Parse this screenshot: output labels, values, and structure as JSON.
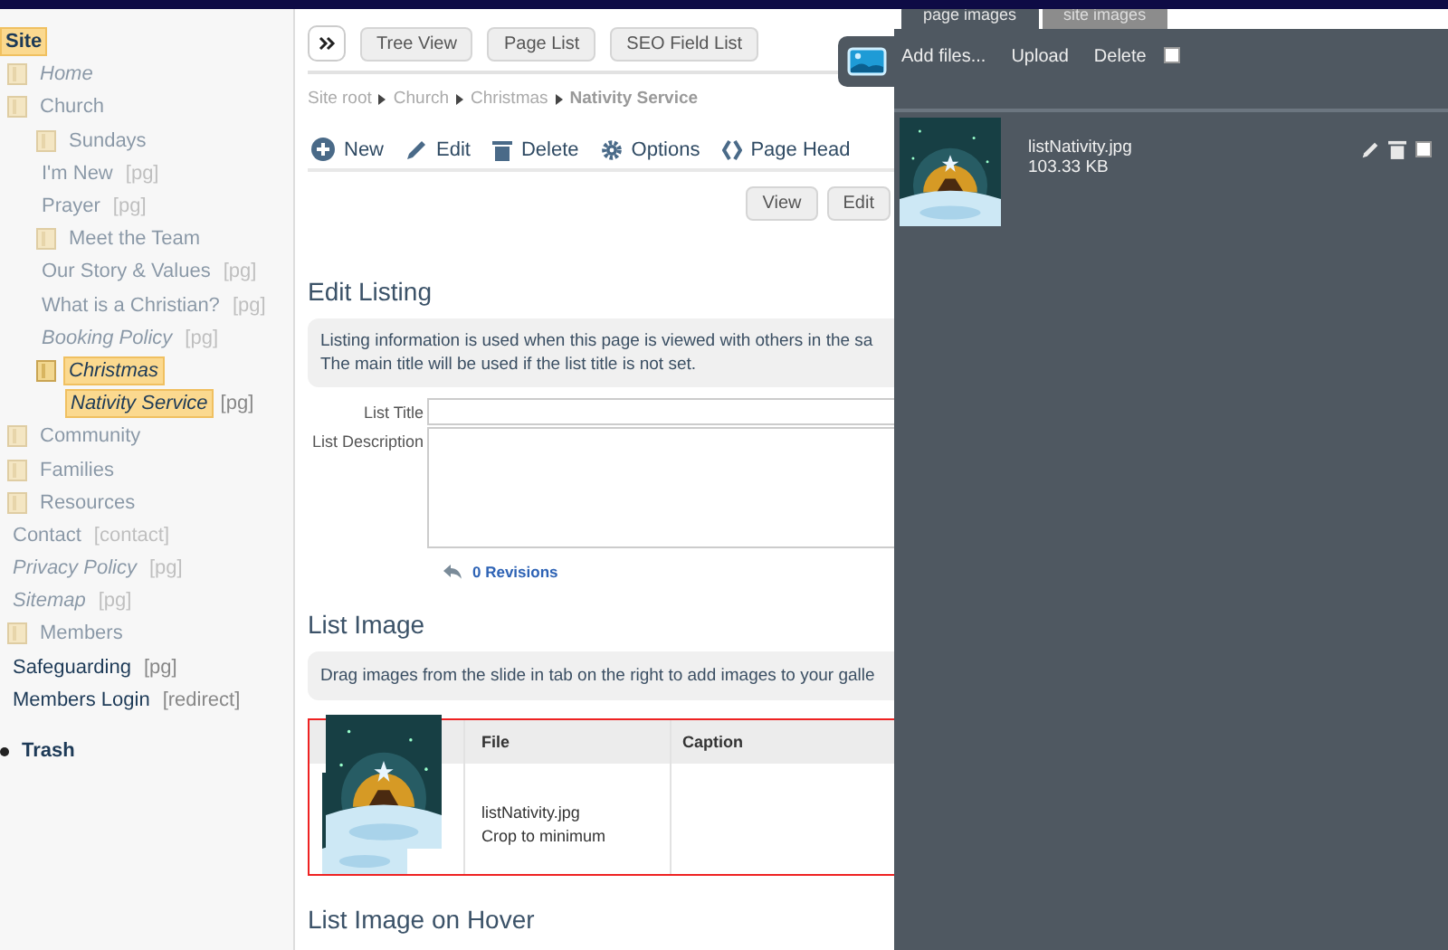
{
  "tree": {
    "items": [
      {
        "label": "Site",
        "kind": "root",
        "italic": false,
        "selected": true,
        "faded": false,
        "children": [
          {
            "label": "Home",
            "kind": "folder",
            "italic": true,
            "selected": false,
            "faded": true
          },
          {
            "label": "Church",
            "kind": "folder",
            "italic": false,
            "selected": false,
            "faded": true,
            "children": [
              {
                "label": "Sundays",
                "kind": "folder",
                "italic": false,
                "selected": false,
                "faded": true
              },
              {
                "label": "I'm New",
                "tag": "[pg]",
                "kind": "page",
                "italic": false,
                "selected": false,
                "faded": true
              },
              {
                "label": "Prayer",
                "tag": "[pg]",
                "kind": "page",
                "italic": false,
                "selected": false,
                "faded": true
              },
              {
                "label": "Meet the Team",
                "kind": "folder",
                "italic": false,
                "selected": false,
                "faded": true
              },
              {
                "label": "Our Story & Values",
                "tag": "[pg]",
                "kind": "page",
                "italic": false,
                "selected": false,
                "faded": true
              },
              {
                "label": "What is a Christian?",
                "tag": "[pg]",
                "kind": "page",
                "italic": false,
                "selected": false,
                "faded": true
              },
              {
                "label": "Booking Policy",
                "tag": "[pg]",
                "kind": "page",
                "italic": true,
                "selected": false,
                "faded": true
              },
              {
                "label": "Christmas",
                "kind": "folder",
                "italic": true,
                "selected": true,
                "faded": false,
                "children": [
                  {
                    "label": "Nativity Service",
                    "tag": "[pg]",
                    "kind": "page",
                    "italic": true,
                    "selected": true,
                    "faded": false
                  }
                ]
              }
            ]
          },
          {
            "label": "Community",
            "kind": "folder",
            "italic": false,
            "selected": false,
            "faded": true
          },
          {
            "label": "Families",
            "kind": "folder",
            "italic": false,
            "selected": false,
            "faded": true
          },
          {
            "label": "Resources",
            "kind": "folder",
            "italic": false,
            "selected": false,
            "faded": true
          },
          {
            "label": "Contact",
            "tag": "[contact]",
            "kind": "page",
            "italic": false,
            "selected": false,
            "faded": true
          },
          {
            "label": "Privacy Policy",
            "tag": "[pg]",
            "kind": "page",
            "italic": true,
            "selected": false,
            "faded": true
          },
          {
            "label": "Sitemap",
            "tag": "[pg]",
            "kind": "page",
            "italic": true,
            "selected": false,
            "faded": true
          },
          {
            "label": "Members",
            "kind": "folder",
            "italic": false,
            "selected": false,
            "faded": true
          },
          {
            "label": "Safeguarding",
            "tag": "[pg]",
            "kind": "page",
            "italic": false,
            "selected": false,
            "faded": false
          },
          {
            "label": "Members Login",
            "tag": "[redirect]",
            "kind": "page",
            "italic": false,
            "selected": false,
            "faded": false
          }
        ]
      }
    ],
    "trash": "Trash"
  },
  "view_tabs": [
    "Tree View",
    "Page List",
    "SEO Field List"
  ],
  "breadcrumb": [
    {
      "label": "Site root",
      "current": false
    },
    {
      "label": "Church",
      "current": false
    },
    {
      "label": "Christmas",
      "current": false
    },
    {
      "label": "Nativity Service",
      "current": true
    }
  ],
  "actions": [
    {
      "label": "New",
      "kind": "plus"
    },
    {
      "label": "Edit",
      "kind": "pencil"
    },
    {
      "label": "Delete",
      "kind": "trash"
    },
    {
      "label": "Options",
      "kind": "gear"
    },
    {
      "label": "Page Head",
      "kind": "code"
    }
  ],
  "mode_buttons": [
    "View",
    "Edit"
  ],
  "edit_listing": {
    "heading": "Edit Listing",
    "info": [
      "Listing information is used when this page is viewed with others in the sa",
      "The main title will be used if the list title is not set."
    ],
    "fields": [
      {
        "label": "List Title",
        "kind": "input"
      },
      {
        "label": "List Description",
        "kind": "textarea"
      }
    ],
    "revisions": "0 Revisions"
  },
  "list_image": {
    "heading": "List Image",
    "info": "Drag images from the slide in tab on the right to add images to your galle",
    "table": {
      "columns": [
        "File",
        "Caption"
      ],
      "rows": [
        {
          "file": "listNativity.jpg",
          "crop": "Crop to minimum"
        }
      ]
    }
  },
  "hover_heading": "List Image on Hover",
  "panel": {
    "tabs": [
      {
        "label": "page images",
        "selected": true
      },
      {
        "label": "site images",
        "selected": false
      }
    ],
    "actions": [
      "Add files...",
      "Upload",
      "Delete"
    ],
    "delete_checked": false,
    "files": [
      {
        "name": "listNativity.jpg",
        "size": "103.33 KB",
        "checked": false
      }
    ]
  }
}
